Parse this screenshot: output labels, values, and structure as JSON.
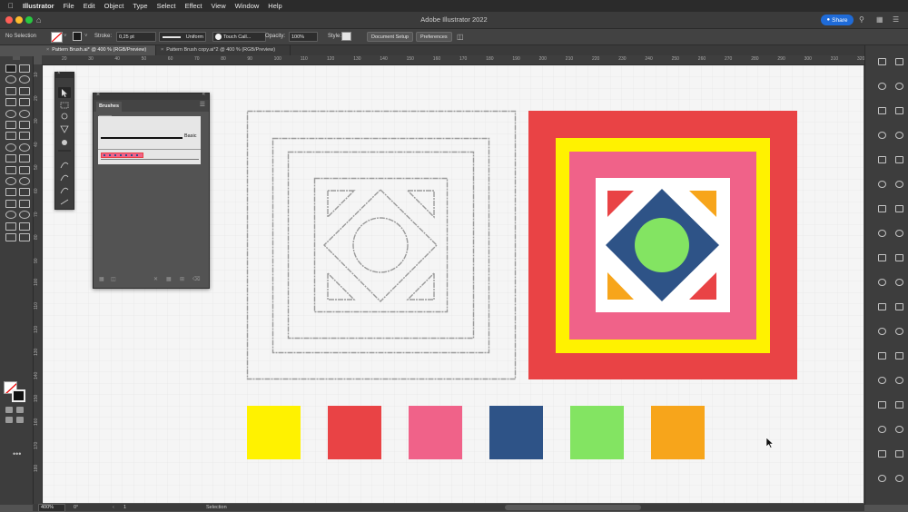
{
  "menubar": {
    "app_name": "Illustrator",
    "items": [
      "File",
      "Edit",
      "Object",
      "Type",
      "Select",
      "Effect",
      "View",
      "Window",
      "Help"
    ]
  },
  "titlebar": {
    "title": "Adobe Illustrator 2022",
    "share_label": "Share"
  },
  "control": {
    "selection_state": "No Selection",
    "stroke_label": "Stroke:",
    "stroke_value": "0,25 pt",
    "profile_label": "Uniform",
    "brush_label": "Touch Call...",
    "opacity_label": "Opacity:",
    "opacity_value": "100%",
    "style_label": "Style:",
    "document_setup": "Document Setup",
    "preferences": "Preferences"
  },
  "tabs": [
    {
      "label": "Pattern Brush.ai* @ 400 % (RGB/Preview)",
      "active": true
    },
    {
      "label": "Pattern Brush copy.ai*2 @ 400 % (RGB/Preview)",
      "active": false
    }
  ],
  "ruler": {
    "top_labels": [
      "20",
      "30",
      "40",
      "50",
      "60",
      "70",
      "80",
      "90",
      "100",
      "110",
      "120",
      "130",
      "140",
      "150",
      "160",
      "170",
      "180",
      "190",
      "200",
      "210",
      "220",
      "230",
      "240",
      "250",
      "260",
      "270",
      "280",
      "290",
      "300",
      "310",
      "320"
    ],
    "left_labels": [
      "10",
      "20",
      "30",
      "40",
      "50",
      "60",
      "70",
      "80",
      "90",
      "100",
      "110",
      "120",
      "130",
      "140",
      "150",
      "160",
      "170",
      "180"
    ]
  },
  "brushes_panel": {
    "title": "Brushes",
    "basic_label": "Basic"
  },
  "swatches": [
    {
      "name": "yellow",
      "color": "#fff200"
    },
    {
      "name": "red",
      "color": "#e94345"
    },
    {
      "name": "pink",
      "color": "#f06289"
    },
    {
      "name": "blue",
      "color": "#2e5387"
    },
    {
      "name": "green",
      "color": "#83e462"
    },
    {
      "name": "orange",
      "color": "#f7a51b"
    }
  ],
  "artwork_colors": {
    "outer": "#e94345",
    "band": "#fff200",
    "inner": "#f06289",
    "center": "#ffffff",
    "diamond": "#2e5387",
    "circle": "#83e462",
    "corner_a": "#e94345",
    "corner_b": "#f7a51b"
  },
  "statusbar": {
    "zoom": "400%",
    "rotation": "0°",
    "artboard": "1",
    "mode": "Selection"
  },
  "icons": [
    "apple-icon",
    "home-icon",
    "share-icon",
    "search-icon",
    "arrange-icon",
    "cursor-icon"
  ]
}
